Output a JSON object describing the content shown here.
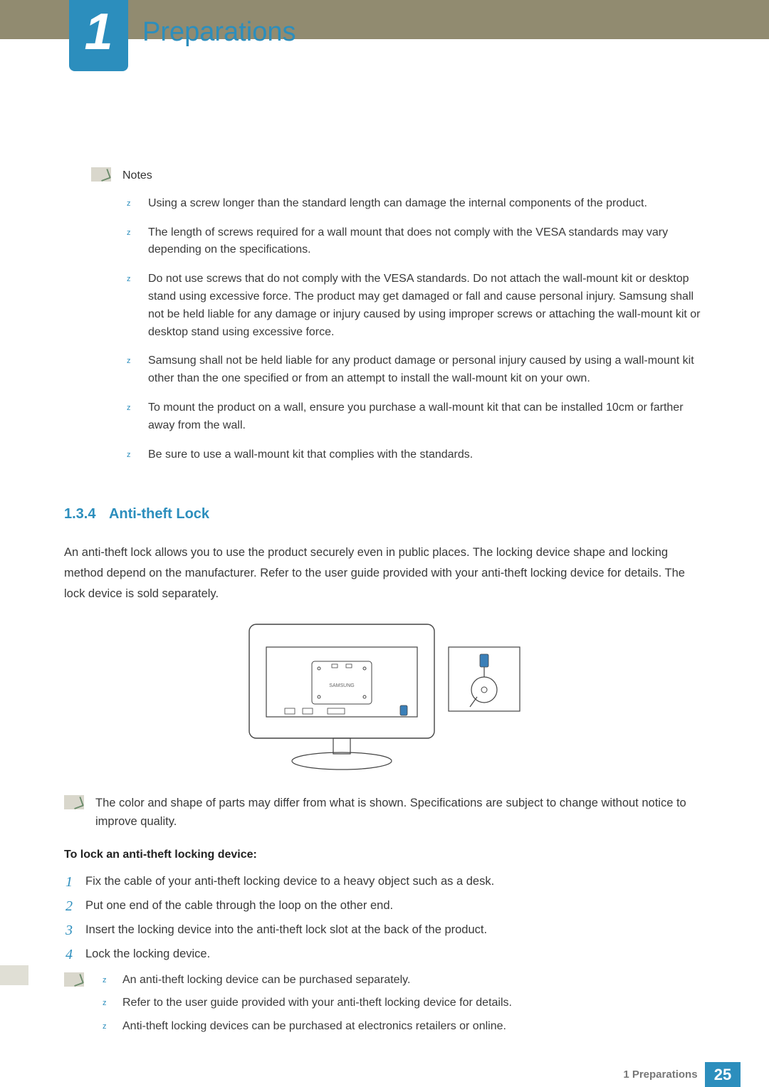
{
  "header": {
    "chapter_number": "1",
    "chapter_title": "Preparations"
  },
  "notes": {
    "heading": "Notes",
    "items": [
      "Using a screw longer than the standard length can damage the internal components of the product.",
      "The length of screws required for a wall mount that does not comply with the VESA standards may vary depending on the specifications.",
      "Do not use screws that do not comply with the VESA standards. Do not attach the wall-mount kit or desktop stand using excessive force. The product may get damaged or fall and cause personal injury. Samsung shall not be held liable for any damage or injury caused by using improper screws or attaching the wall-mount kit or desktop stand using excessive force.",
      "Samsung shall not be held liable for any product damage or personal injury caused by using a wall-mount kit other than the one specified or from an attempt to install the wall-mount kit on your own.",
      "To mount the product on a wall, ensure you purchase a wall-mount kit that can be installed 10cm or farther away from the wall.",
      "Be sure to use a wall-mount kit that complies with the standards."
    ]
  },
  "section": {
    "number": "1.3.4",
    "title": "Anti-theft Lock",
    "intro": "An anti-theft lock allows you to use the product securely even in public places. The locking device shape and locking method depend on the manufacturer. Refer to the user guide provided with your anti-theft locking device for details. The lock device is sold separately.",
    "diagram_label": "SAMSUNG",
    "note": "The color and shape of parts may differ from what is shown. Specifications are subject to change without notice to improve quality.",
    "steps_heading": "To lock an anti-theft locking device:",
    "steps": [
      "Fix the cable of your anti-theft locking device to a heavy object such as a desk.",
      "Put one end of the cable through the loop on the other end.",
      "Insert the locking device into the anti-theft lock slot at the back of the product.",
      "Lock the locking device."
    ],
    "sub_notes": [
      "An anti-theft locking device can be purchased separately.",
      "Refer to the user guide provided with your anti-theft locking device for details.",
      "Anti-theft locking devices can be purchased at electronics retailers or online."
    ]
  },
  "footer": {
    "label": "1 Preparations",
    "page": "25"
  }
}
